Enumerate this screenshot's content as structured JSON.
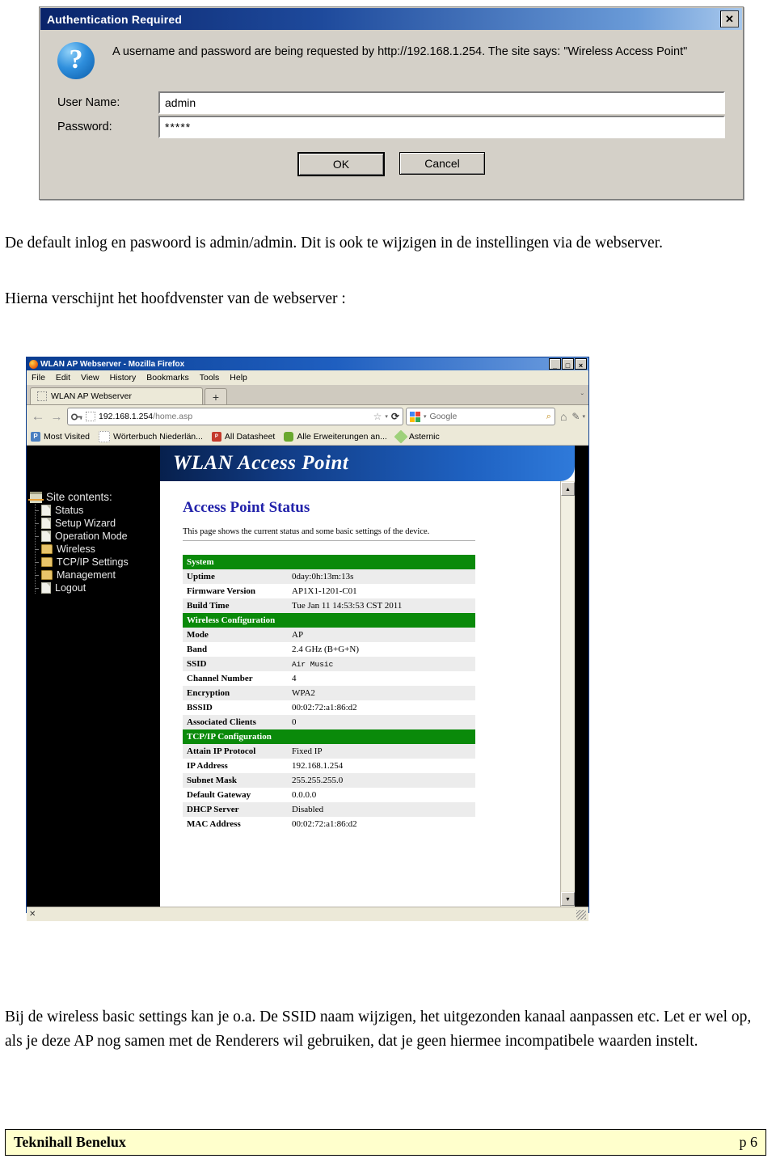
{
  "auth_dialog": {
    "title": "Authentication Required",
    "close_label": "✕",
    "icon": "question-mark-icon",
    "message": "A username and password are being requested by http://192.168.1.254. The site says: \"Wireless Access Point\"",
    "username_label": "User Name:",
    "username_value": "admin",
    "password_label": "Password:",
    "password_value": "*****",
    "ok_label": "OK",
    "cancel_label": "Cancel"
  },
  "prose": {
    "p1": "De default inlog en paswoord is admin/admin. Dit is ook te wijzigen in de instellingen via de webserver.",
    "p2": "Hierna verschijnt het hoofdvenster van de webserver :",
    "p3": "Bij de wireless basic settings kan je o.a. De SSID naam wijzigen, het uitgezonden kanaal aanpassen etc. Let er wel op, als je deze AP nog samen met de Renderers wil gebruiken, dat je geen hiermee incompatibele waarden instelt."
  },
  "browser": {
    "window_title": "WLAN AP Webserver - Mozilla Firefox",
    "minimize_label": "_",
    "maximize_label": "□",
    "close_label": "×",
    "menus": [
      "File",
      "Edit",
      "View",
      "History",
      "Bookmarks",
      "Tools",
      "Help"
    ],
    "tab": {
      "label": "WLAN AP Webserver",
      "newtab_label": "+",
      "list_all_label": "ˇ"
    },
    "nav": {
      "back": "←",
      "forward": "→",
      "reload": "⟳",
      "home": "⌂",
      "tools": "✎",
      "overflow": "▾"
    },
    "url_host": "192.168.1.254",
    "url_path": "/home.asp",
    "star_label": "☆",
    "search": {
      "engine": "Google",
      "caret": "▾",
      "magnifier": "⌕"
    },
    "bookmarks": [
      {
        "label": "Most Visited",
        "icon": "bookmark-icon",
        "color": "#4a7fc1"
      },
      {
        "label": "Wörterbuch Niederlän...",
        "icon": "blank-favicon",
        "color": "#c9c6bb"
      },
      {
        "label": "All Datasheet",
        "icon": "pdf-icon",
        "color": "#c43a2b"
      },
      {
        "label": "Alle Erweiterungen an...",
        "icon": "puzzle-icon",
        "color": "#6aa82e"
      },
      {
        "label": "Asternic",
        "icon": "diamond-icon",
        "color": "#9ed17a"
      }
    ],
    "statusbar": {
      "close_label": "✕",
      "grip": "resize-grip"
    }
  },
  "access_point": {
    "banner_title": "WLAN Access Point",
    "sidebar": {
      "heading": "Site contents:",
      "items": [
        {
          "label": "Status",
          "icon": "document-icon"
        },
        {
          "label": "Setup Wizard",
          "icon": "document-icon"
        },
        {
          "label": "Operation Mode",
          "icon": "document-icon"
        },
        {
          "label": "Wireless",
          "icon": "folder-icon"
        },
        {
          "label": "TCP/IP Settings",
          "icon": "folder-icon"
        },
        {
          "label": "Management",
          "icon": "folder-icon"
        },
        {
          "label": "Logout",
          "icon": "document-icon"
        }
      ]
    },
    "page_title": "Access Point Status",
    "page_desc": "This page shows the current status and some basic settings of the device.",
    "sections": [
      {
        "title": "System",
        "rows": [
          {
            "key": "Uptime",
            "value": "0day:0h:13m:13s"
          },
          {
            "key": "Firmware Version",
            "value": "AP1X1-1201-C01"
          },
          {
            "key": "Build Time",
            "value": "Tue Jan 11 14:53:53 CST 2011"
          }
        ]
      },
      {
        "title": "Wireless Configuration",
        "rows": [
          {
            "key": "Mode",
            "value": "AP"
          },
          {
            "key": "Band",
            "value": "2.4 GHz (B+G+N)"
          },
          {
            "key": "SSID",
            "value": "Air Music",
            "mono": true
          },
          {
            "key": "Channel Number",
            "value": "4"
          },
          {
            "key": "Encryption",
            "value": "WPA2"
          },
          {
            "key": "BSSID",
            "value": "00:02:72:a1:86:d2"
          },
          {
            "key": "Associated Clients",
            "value": "0"
          }
        ]
      },
      {
        "title": "TCP/IP Configuration",
        "rows": [
          {
            "key": "Attain IP Protocol",
            "value": "Fixed IP"
          },
          {
            "key": "IP Address",
            "value": "192.168.1.254"
          },
          {
            "key": "Subnet Mask",
            "value": "255.255.255.0"
          },
          {
            "key": "Default Gateway",
            "value": "0.0.0.0"
          },
          {
            "key": "DHCP Server",
            "value": "Disabled"
          },
          {
            "key": "MAC Address",
            "value": "00:02:72:a1:86:d2"
          }
        ]
      }
    ],
    "scrollbar": {
      "up": "▲",
      "down": "▼"
    }
  },
  "footer": {
    "left": "Teknihall Benelux",
    "right": "p  6"
  },
  "colors": {
    "banner_blue": "#113c86",
    "section_green": "#0a8a0a",
    "heading_blue": "#2222aa",
    "footer_bg": "#ffffcc"
  }
}
